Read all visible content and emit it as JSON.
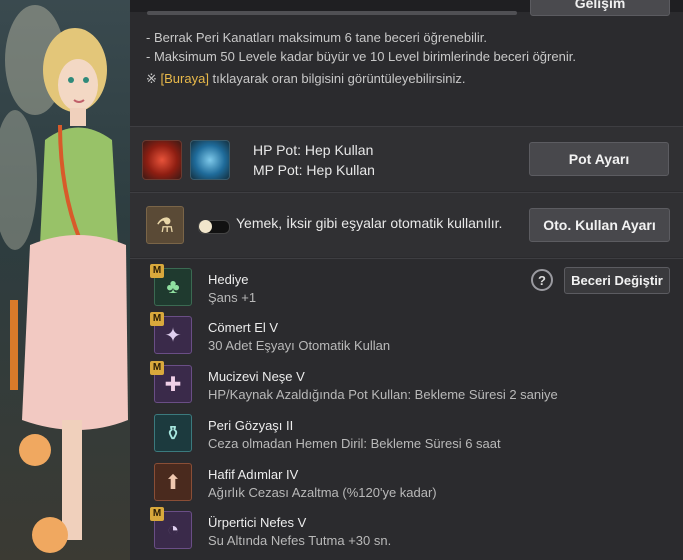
{
  "top": {
    "gelisim_label": "Gelişim"
  },
  "info": {
    "line1": "- Berrak Peri Kanatları maksimum 6 tane beceri öğrenebilir.",
    "line2": "- Maksimum 50 Levele kadar büyür ve 10 Level birimlerinde beceri öğrenir.",
    "note_prefix": "※ ",
    "note_link": "[Buraya]",
    "note_suffix": " tıklayarak oran bilgisini görüntüleyebilirsiniz."
  },
  "pot": {
    "hp_text": "HP Pot: Hep Kullan",
    "mp_text": "MP Pot: Hep Kullan",
    "button_label": "Pot Ayarı"
  },
  "auto_use": {
    "text": "Yemek, İksir gibi eşyalar otomatik kullanılır.",
    "button_label": "Oto. Kullan Ayarı",
    "toggle_on": false
  },
  "skills_header": {
    "help_label": "?",
    "change_button": "Beceri Değiştir"
  },
  "skills": [
    {
      "name": "Hediye",
      "desc": "Şans +1",
      "badge": "M",
      "icon": "clover-icon"
    },
    {
      "name": "Cömert El V",
      "desc": "30 Adet Eşyayı Otomatik Kullan",
      "badge": "M",
      "icon": "fairy-icon"
    },
    {
      "name": "Mucizevi Neşe V",
      "desc": "HP/Kaynak Azaldığında Pot Kullan: Bekleme Süresi 2 saniye",
      "badge": "M",
      "icon": "potion-sparkle-icon"
    },
    {
      "name": "Peri Gözyaşı II",
      "desc": "Ceza olmadan Hemen Diril: Bekleme Süresi 6 saat",
      "badge": "",
      "icon": "tear-vase-icon"
    },
    {
      "name": "Hafif Adımlar IV",
      "desc": "Ağırlık Cezası Azaltma (%120'ye kadar)",
      "badge": "",
      "icon": "weight-icon"
    },
    {
      "name": "Ürpertici Nefes V",
      "desc": "Su Altında Nefes Tutma +30 sn.",
      "badge": "M",
      "icon": "breath-icon"
    }
  ]
}
